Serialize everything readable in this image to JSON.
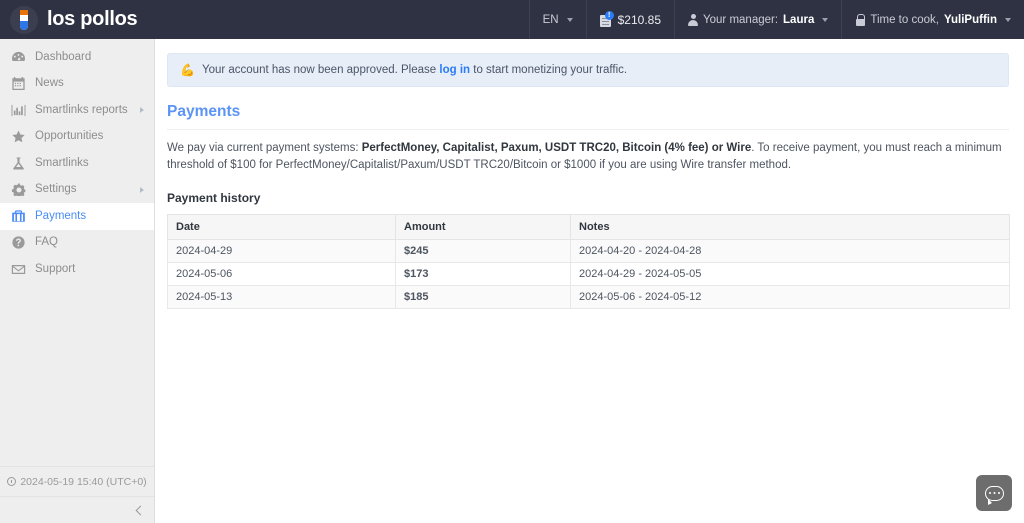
{
  "topbar": {
    "brand": "los pollos",
    "brand_icon": "test-tube-icon",
    "language": "EN",
    "balance": "$210.85",
    "balance_badge": "!",
    "manager_prefix": "Your manager:",
    "manager_name": "Laura",
    "user_prefix": "Time to cook,",
    "user_name": "YuliPuffin"
  },
  "sidebar": {
    "items": [
      {
        "label": "Dashboard",
        "icon": "dashboard-icon",
        "active": false,
        "submenu": false
      },
      {
        "label": "News",
        "icon": "calendar-icon",
        "active": false,
        "submenu": false
      },
      {
        "label": "Smartlinks reports",
        "icon": "bar-chart-icon",
        "active": false,
        "submenu": true
      },
      {
        "label": "Opportunities",
        "icon": "star-icon",
        "active": false,
        "submenu": false
      },
      {
        "label": "Smartlinks",
        "icon": "flask-icon",
        "active": false,
        "submenu": false
      },
      {
        "label": "Settings",
        "icon": "gear-icon",
        "active": false,
        "submenu": true
      },
      {
        "label": "Payments",
        "icon": "briefcase-icon",
        "active": true,
        "submenu": false
      },
      {
        "label": "FAQ",
        "icon": "question-circle-icon",
        "active": false,
        "submenu": false
      },
      {
        "label": "Support",
        "icon": "envelope-icon",
        "active": false,
        "submenu": false
      }
    ],
    "timestamp": "2024-05-19 15:40 (UTC+0)",
    "collapse_icon": "chevron-left-icon"
  },
  "alert": {
    "emoji": "💪",
    "text_before": "Your account has now been approved. Please",
    "link": "log in",
    "text_after": "to start monetizing your traffic."
  },
  "page": {
    "title": "Payments",
    "intro_1": "We pay via current payment systems:",
    "intro_bold": "PerfectMoney, Capitalist, Paxum, USDT TRC20, Bitcoin (4% fee) or Wire",
    "intro_2": ". To receive payment, you must reach a minimum threshold of $100 for PerfectMoney/Capitalist/Paxum/USDT TRC20/Bitcoin or $1000 if you are using Wire transfer method.",
    "section_title": "Payment history"
  },
  "table": {
    "columns": [
      "Date",
      "Amount",
      "Notes"
    ],
    "rows": [
      {
        "date": "2024-04-29",
        "amount": "$245",
        "notes": "2024-04-20 - 2024-04-28"
      },
      {
        "date": "2024-05-06",
        "amount": "$173",
        "notes": "2024-04-29 - 2024-05-05"
      },
      {
        "date": "2024-05-13",
        "amount": "$185",
        "notes": "2024-05-06 - 2024-05-12"
      }
    ]
  },
  "chat": {
    "icon": "chat-bubble-icon"
  },
  "colors": {
    "topbar_bg": "#2f3242",
    "sidebar_bg": "#eeeeee",
    "accent_blue": "#5b94f5",
    "amount_green": "#49a942",
    "alert_bg": "#e7eef8"
  }
}
